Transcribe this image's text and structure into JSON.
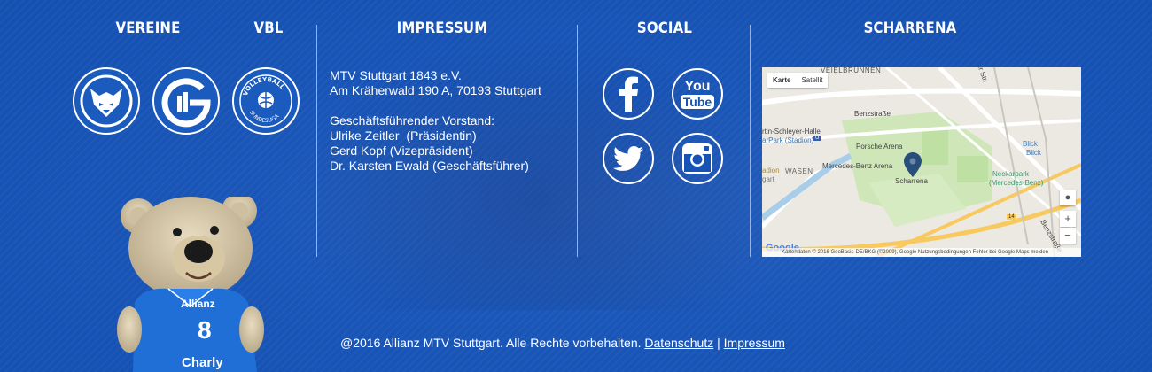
{
  "columns": {
    "vereine": "VEREINE",
    "vbl": "VBL",
    "impressum": "IMPRESSUM",
    "social": "SOCIAL",
    "scharrena": "SCHARRENA"
  },
  "impressum": {
    "line1": "MTV Stuttgart 1843 e.V.",
    "line2": "Am Kräherwald 190 A, 70193 Stuttgart",
    "line3": "Geschäftsführender Vorstand:",
    "line4": "Ulrike Zeitler  (Präsidentin)",
    "line5": "Gerd Kopf (Vizepräsident)",
    "line6": "Dr. Karsten Ewald (Geschäftsführer)"
  },
  "vbl_logo": {
    "text_top": "VOLLEYBALL",
    "text_bottom": "BUNDESLIGA"
  },
  "social": {
    "facebook": "facebook-icon",
    "youtube_top": "You",
    "youtube_bottom": "Tube",
    "twitter": "twitter-icon",
    "instagram": "instagram-icon"
  },
  "map": {
    "tab_map": "Karte",
    "tab_satellite": "Satellit",
    "labels": {
      "veielbrunnen": "VEIELBRUNNEN",
      "benzstrasse1": "Benzstraße",
      "halle": "rtin-Schleyer-Halle",
      "neckarpark_stadion": "arPark (Stadion)",
      "porsche": "Porsche Arena",
      "mercedes": "Mercedes-Benz Arena",
      "scharrena": "Scharrena",
      "wasen": "WASEN",
      "stadion": "adion",
      "gart": "gart",
      "blick1": "Blick",
      "blick2": "Blick",
      "neckarpark1": "Neckarpark",
      "neckarpark2": "(Mercedes-Benz)",
      "route": "14",
      "benzstrasse2": "Benzstraße",
      "str": "er Str."
    },
    "zoom_in": "+",
    "zoom_out": "−",
    "google": "Google",
    "attribution": "Kartendaten © 2016 GeoBasis-DE/BKG (©2009), Google    Nutzungsbedingungen        Fehler bei Google Maps melden"
  },
  "mascot": {
    "shirt_brand": "Allianz",
    "number": "8",
    "name": "Charly"
  },
  "footer": {
    "copyright": "@2016 Allianz MTV Stuttgart. Alle Rechte vorbehalten.",
    "link_datenschutz": "Datenschutz",
    "separator": "|",
    "link_impressum": "Impressum"
  },
  "colors": {
    "background": "#1553b5",
    "map_road_yellow": "#f7c95e",
    "map_water": "#a8cde8",
    "pin": "#2a4e7a"
  }
}
